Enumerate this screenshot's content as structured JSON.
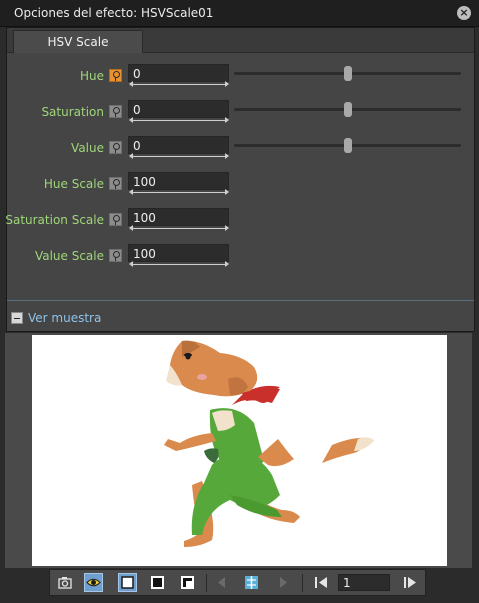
{
  "window": {
    "title": "Opciones del efecto: HSVScale01"
  },
  "tabs": [
    {
      "label": "HSV Scale"
    }
  ],
  "params": [
    {
      "label": "Hue",
      "value": "0",
      "slider": 0.5,
      "key_active": true
    },
    {
      "label": "Saturation",
      "value": "0",
      "slider": 0.5,
      "key_active": false
    },
    {
      "label": "Value",
      "value": "0",
      "slider": 0.5,
      "key_active": false
    },
    {
      "label": "Hue Scale",
      "value": "100",
      "key_active": false
    },
    {
      "label": "Saturation Scale",
      "value": "100",
      "key_active": false
    },
    {
      "label": "Value Scale",
      "value": "100",
      "key_active": false
    }
  ],
  "preview": {
    "toggle_label": "Ver muestra"
  },
  "toolbar": {
    "frame_value": "1",
    "icons": [
      "camera-icon",
      "eye-icon",
      "white-bg-icon",
      "black-bg-icon",
      "checker-bg-icon",
      "prev-icon",
      "compare-icon",
      "next-icon",
      "first-frame-icon",
      "last-frame-icon"
    ]
  },
  "colors": {
    "label_green": "#9fd67a",
    "link_blue": "#8ec3ea",
    "key_orange": "#e8922f",
    "toggle_on": "#6f9fcf"
  }
}
